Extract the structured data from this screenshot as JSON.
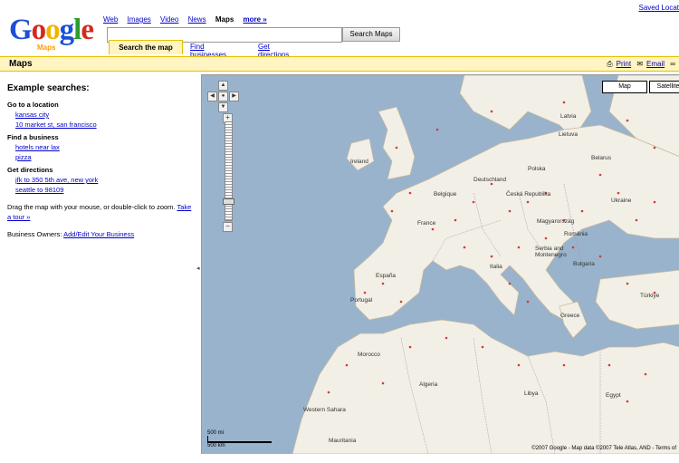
{
  "header": {
    "saved_locations": "Saved Locat",
    "logo_text": "Google",
    "logo_sub": "Maps",
    "nav": [
      "Web",
      "Images",
      "Video",
      "News",
      "Maps",
      "more »"
    ],
    "search_value": "",
    "search_button": "Search Maps",
    "tabs": {
      "active": "Search the map",
      "find_businesses": "Find businesses",
      "get_directions": "Get directions"
    }
  },
  "titlebar": {
    "title": "Maps",
    "print": "Print",
    "email": "Email"
  },
  "sidebar": {
    "heading": "Example searches:",
    "sections": [
      {
        "title": "Go to a location",
        "items": [
          "kansas city",
          "10 market st, san francisco"
        ]
      },
      {
        "title": "Find a business",
        "items": [
          "hotels near lax",
          "pizza"
        ]
      },
      {
        "title": "Get directions",
        "items": [
          "jfk to 350 5th ave, new york",
          "seattle to 98109"
        ]
      }
    ],
    "drag_text": "Drag the map with your mouse, or double-click to zoom.",
    "tour_link": "Take a tour »",
    "owners_label": "Business Owners:",
    "owners_link": "Add/Edit Your Business"
  },
  "map": {
    "type_map": "Map",
    "type_sat": "Satellite",
    "scale_top": "500 mi",
    "scale_bottom": "500 km",
    "copyright": "©2007 Google - Map data ©2007 Tele Atlas, AND - Terms of",
    "labels": {
      "deutschland": "Deutschland",
      "france": "France",
      "espana": "España",
      "italia": "Italia",
      "morocco": "Morocco",
      "algeria": "Algeria",
      "libya": "Libya",
      "egypt": "Egypt",
      "mauritania": "Mauritania",
      "ireland": "Ireland",
      "belgique": "Belgique",
      "polska": "Polska",
      "belarus": "Belarus",
      "ukraine": "Ukraine",
      "romania": "România",
      "turkiye": "Türkiye",
      "bulgaria": "Bulgaria",
      "serbia": "Serbia and Montenegro",
      "portugal": "Portugal",
      "magyarorszag": "Magyarország",
      "ceska": "Česká Republika",
      "latvia": "Latvia",
      "lietuva": "Lietuva",
      "western_sahara": "Western Sahara",
      "greece": "Greece"
    }
  }
}
